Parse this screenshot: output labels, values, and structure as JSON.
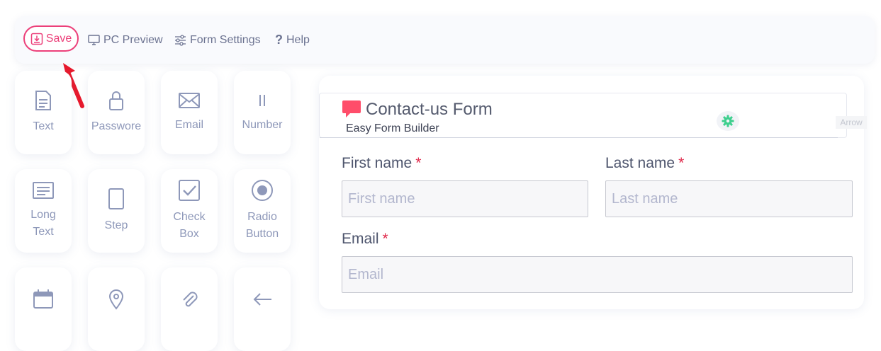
{
  "toolbar": {
    "save_label": "Save",
    "pc_preview_label": "PC Preview",
    "form_settings_label": "Form Settings",
    "help_label": "Help"
  },
  "palette": {
    "items": [
      {
        "label": "Text",
        "icon": "document-icon"
      },
      {
        "label": "Passwore",
        "icon": "lock-icon"
      },
      {
        "label": "Email",
        "icon": "envelope-icon"
      },
      {
        "label": "Number",
        "icon": "number-icon"
      },
      {
        "label": "Long\nText",
        "icon": "long-text-icon"
      },
      {
        "label": "Step",
        "icon": "step-icon"
      },
      {
        "label": "Check\nBox",
        "icon": "checkbox-icon"
      },
      {
        "label": "Radio\nButton",
        "icon": "radio-icon"
      },
      {
        "label": "",
        "icon": "calendar-icon"
      },
      {
        "label": "",
        "icon": "map-pin-icon"
      },
      {
        "label": "",
        "icon": "attachment-icon"
      },
      {
        "label": "",
        "icon": "arrow-left-icon"
      }
    ]
  },
  "form": {
    "title": "Contact-us Form",
    "subtitle": "Easy Form Builder",
    "arrow_tag": "Arrow",
    "fields": {
      "first_name": {
        "label": "First name",
        "placeholder": "First name",
        "required": "*"
      },
      "last_name": {
        "label": "Last name",
        "placeholder": "Last name",
        "required": "*"
      },
      "email": {
        "label": "Email",
        "placeholder": "Email",
        "required": "*"
      }
    }
  },
  "colors": {
    "accent": "#ec407a",
    "icon_gray": "#8e98b9",
    "required": "#e0294b",
    "gear_green": "#3ecf8e",
    "chat_red": "#ff4d6a"
  }
}
